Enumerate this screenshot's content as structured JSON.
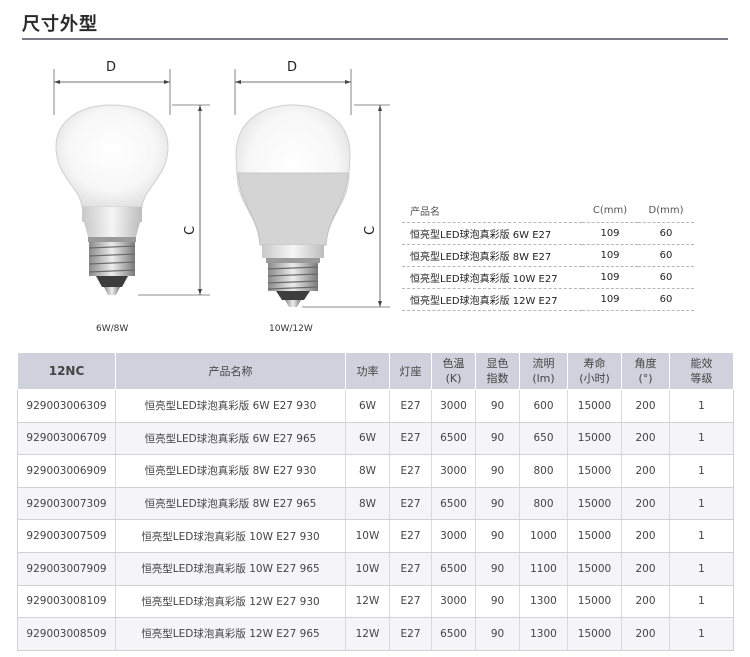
{
  "section": {
    "title": "尺寸外型"
  },
  "diagram": {
    "dimension_width": "D",
    "dimension_height": "C",
    "bulbs": [
      {
        "caption": "6W/8W",
        "dimension_width": "D",
        "dimension_height": "C"
      },
      {
        "caption": "10W/12W",
        "dimension_width": "D",
        "dimension_height": "C"
      }
    ]
  },
  "size_table": {
    "headers": [
      "产品名",
      "C(mm)",
      "D(mm)"
    ],
    "rows": [
      [
        "恒亮型LED球泡真彩版 6W E27",
        "109",
        "60"
      ],
      [
        "恒亮型LED球泡真彩版 8W E27",
        "109",
        "60"
      ],
      [
        "恒亮型LED球泡真彩版 10W E27",
        "109",
        "60"
      ],
      [
        "恒亮型LED球泡真彩版 12W E27",
        "109",
        "60"
      ]
    ]
  },
  "spec_table": {
    "headers": [
      [
        "12NC"
      ],
      [
        "产品名称"
      ],
      [
        "功率"
      ],
      [
        "灯座"
      ],
      [
        "色温",
        "(K)"
      ],
      [
        "显色",
        "指数"
      ],
      [
        "流明",
        "(lm)"
      ],
      [
        "寿命",
        "(小时)"
      ],
      [
        "角度",
        "(°)"
      ],
      [
        "能效",
        "等级"
      ]
    ],
    "rows": [
      [
        "929003006309",
        "恒亮型LED球泡真彩版 6W E27 930",
        "6W",
        "E27",
        "3000",
        "90",
        "600",
        "15000",
        "200",
        "1"
      ],
      [
        "929003006709",
        "恒亮型LED球泡真彩版 6W E27 965",
        "6W",
        "E27",
        "6500",
        "90",
        "650",
        "15000",
        "200",
        "1"
      ],
      [
        "929003006909",
        "恒亮型LED球泡真彩版 8W E27 930",
        "8W",
        "E27",
        "3000",
        "90",
        "800",
        "15000",
        "200",
        "1"
      ],
      [
        "929003007309",
        "恒亮型LED球泡真彩版 8W E27 965",
        "8W",
        "E27",
        "6500",
        "90",
        "800",
        "15000",
        "200",
        "1"
      ],
      [
        "929003007509",
        "恒亮型LED球泡真彩版 10W E27 930",
        "10W",
        "E27",
        "3000",
        "90",
        "1000",
        "15000",
        "200",
        "1"
      ],
      [
        "929003007909",
        "恒亮型LED球泡真彩版 10W E27 965",
        "10W",
        "E27",
        "6500",
        "90",
        "1100",
        "15000",
        "200",
        "1"
      ],
      [
        "929003008109",
        "恒亮型LED球泡真彩版 12W E27 930",
        "12W",
        "E27",
        "3000",
        "90",
        "1300",
        "15000",
        "200",
        "1"
      ],
      [
        "929003008509",
        "恒亮型LED球泡真彩版 12W E27 965",
        "12W",
        "E27",
        "6500",
        "90",
        "1300",
        "15000",
        "200",
        "1"
      ]
    ]
  }
}
